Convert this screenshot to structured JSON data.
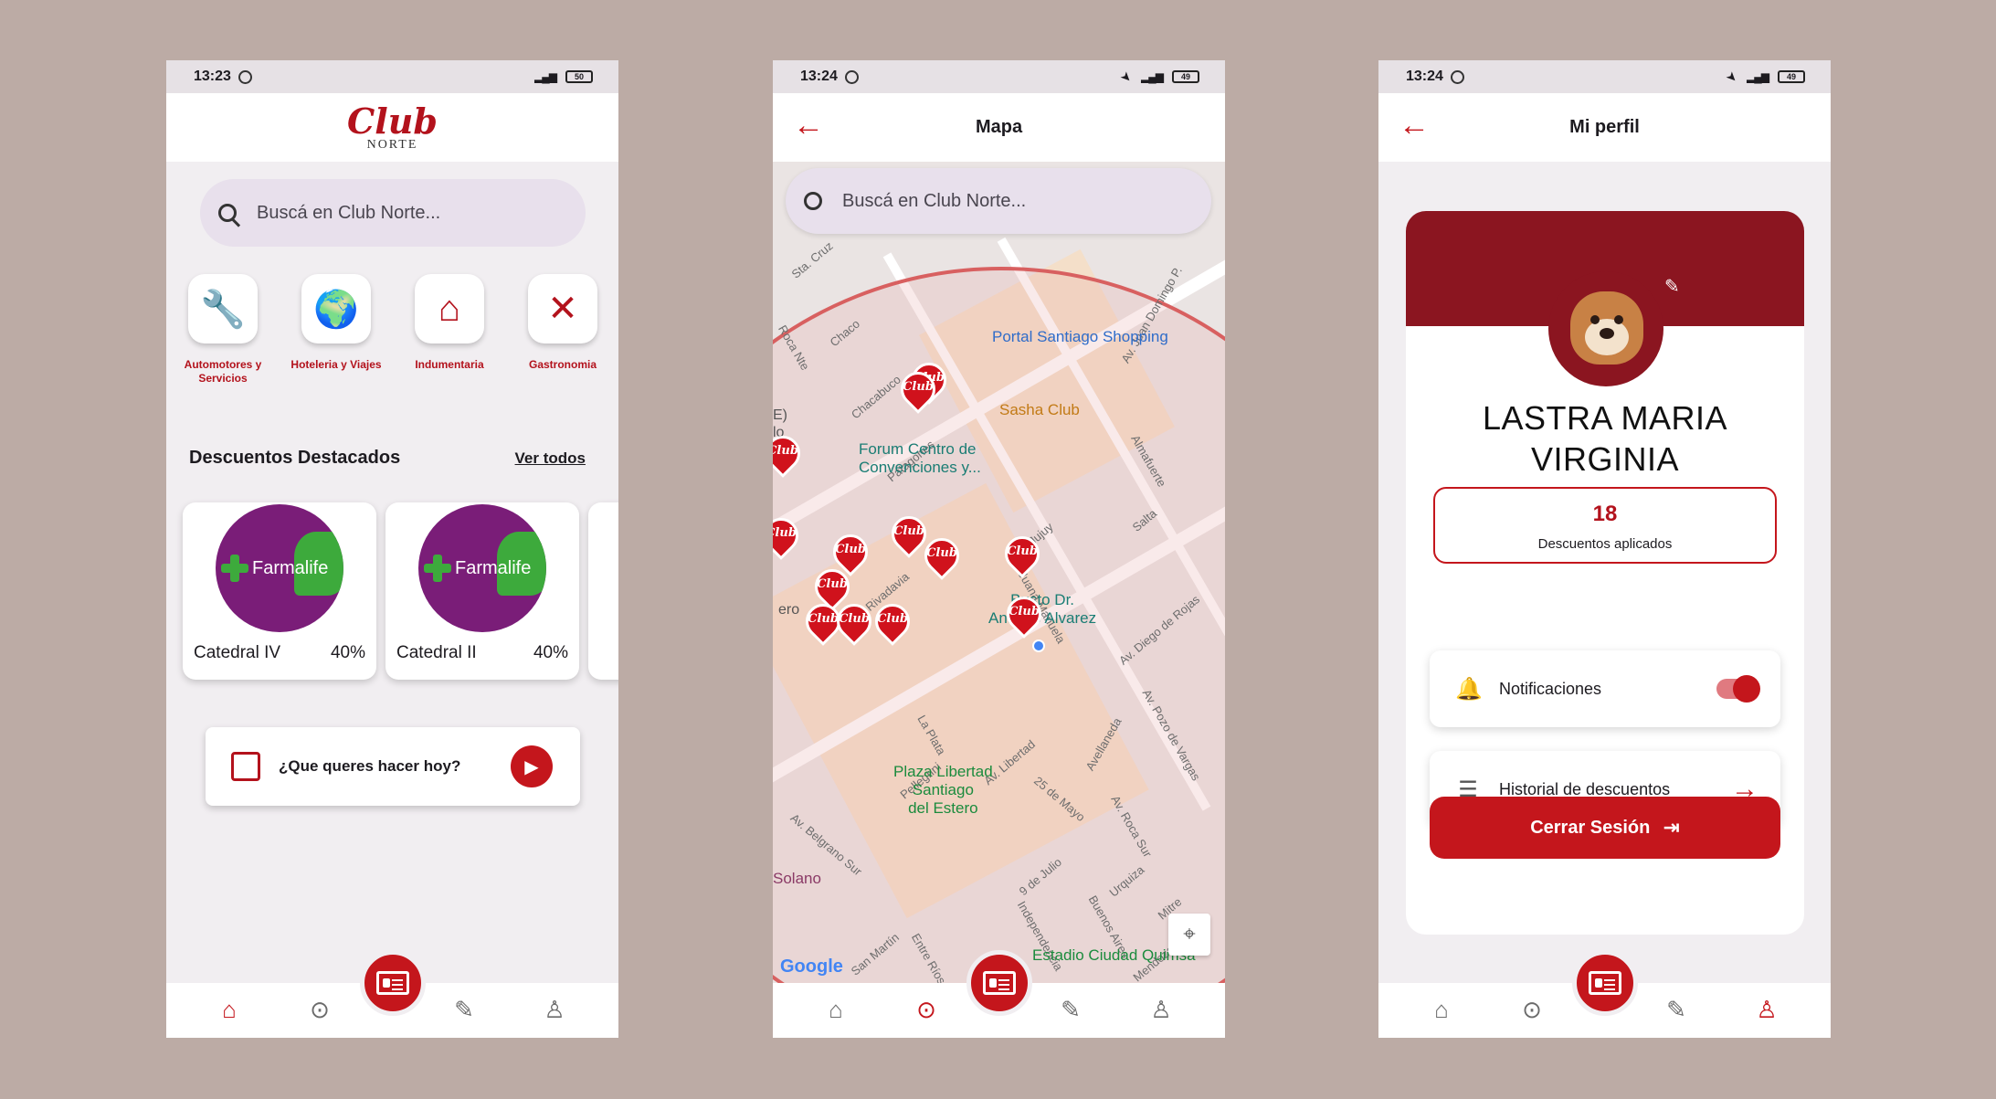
{
  "colors": {
    "brand": "#c4161c",
    "brand_dark": "#8b1520",
    "background": "#bcaba5",
    "farmalife_purple": "#7a1d78",
    "farmalife_green": "#3daa3c"
  },
  "screen1": {
    "status": {
      "time": "13:23",
      "battery": "50"
    },
    "logo": {
      "club": "Club",
      "norte": "NORTE"
    },
    "search_placeholder": "Buscá en Club Norte...",
    "categories": [
      {
        "label": "Automotores y Servicios",
        "icon": "car-tools-icon"
      },
      {
        "label": "Hoteleria y Viajes",
        "icon": "globe-plane-icon"
      },
      {
        "label": "Indumentaria",
        "icon": "hanger-icon"
      },
      {
        "label": "Gastronomia",
        "icon": "fork-knife-icon"
      }
    ],
    "section_title": "Descuentos Destacados",
    "see_all": "Ver todos",
    "discounts": [
      {
        "brand": "Farmalife",
        "name": "Catedral IV",
        "percent": "40%"
      },
      {
        "brand": "Farmalife",
        "name": "Catedral II",
        "percent": "40%"
      }
    ],
    "cta_text": "¿Que queres hacer hoy?"
  },
  "screen2": {
    "status": {
      "time": "13:24",
      "battery": "49"
    },
    "title": "Mapa",
    "search_placeholder": "Buscá en Club Norte...",
    "map_labels": {
      "portal": "Portal Santiago Shopping",
      "sasha": "Sasha Club",
      "forum": "Forum Centro de\nConvenciones y...",
      "busto": "Busto Dr.\nAntonio Alvarez",
      "plaza": "Plaza Libertad\nSantiago\ndel Estero",
      "estadio": "Estadio Ciudad Quimsa",
      "solano": "Solano",
      "google": "Google",
      "streets": {
        "sta_cruz": "Sta. Cruz",
        "roca_nte": "Roca Nte",
        "chaco": "Chaco",
        "chacabuco": "Chacabuco",
        "patagones": "Patagones",
        "av_juan_domingo": "Av. Juan Domingo P.",
        "almafuerte": "Almafuerte",
        "salta": "Salta",
        "jujuy": "Jujuy",
        "juana_manuela": "Juana Manuela",
        "av_rivadavia": "Av. Rivadavia",
        "av_diego_de_rojas": "Av. Diego de Rojas",
        "la_plata": "La Plata",
        "av_libertad": "Av. Libertad",
        "av_belgrano_sur": "Av. Belgrano Sur",
        "pellegrini": "Pellegrini",
        "veinticinco_mayo": "25 de Mayo",
        "av_pozo_de_vargas": "Av. Pozo de Vargas",
        "avellaneda": "Avellaneda",
        "av_roca_sur": "Av. Roca Sur",
        "urquiza": "Urquiza",
        "nueve_julio": "9 de Julio",
        "independencia": "Independencia",
        "buenos_aires": "Buenos Aires",
        "san_martin": "San Martín",
        "entre_rios": "Entre Ríos",
        "mitre": "Mitre",
        "mendoza": "Mendoza"
      },
      "fragments": {
        "e_lo": "E)\nlo",
        "ero": "ero"
      },
      "pin_text": "Club"
    }
  },
  "screen3": {
    "status": {
      "time": "13:24",
      "battery": "49"
    },
    "title": "Mi perfil",
    "name": "LASTRA MARIA VIRGINIA",
    "discounts_count": "18",
    "discounts_label": "Descuentos aplicados",
    "notifications_label": "Notificaciones",
    "notifications_on": true,
    "history_label": "Historial de descuentos",
    "logout_label": "Cerrar Sesión"
  },
  "nav": {
    "items": [
      "home-icon",
      "map-pin-icon",
      "id-card-icon",
      "ticket-icon",
      "person-icon"
    ]
  }
}
